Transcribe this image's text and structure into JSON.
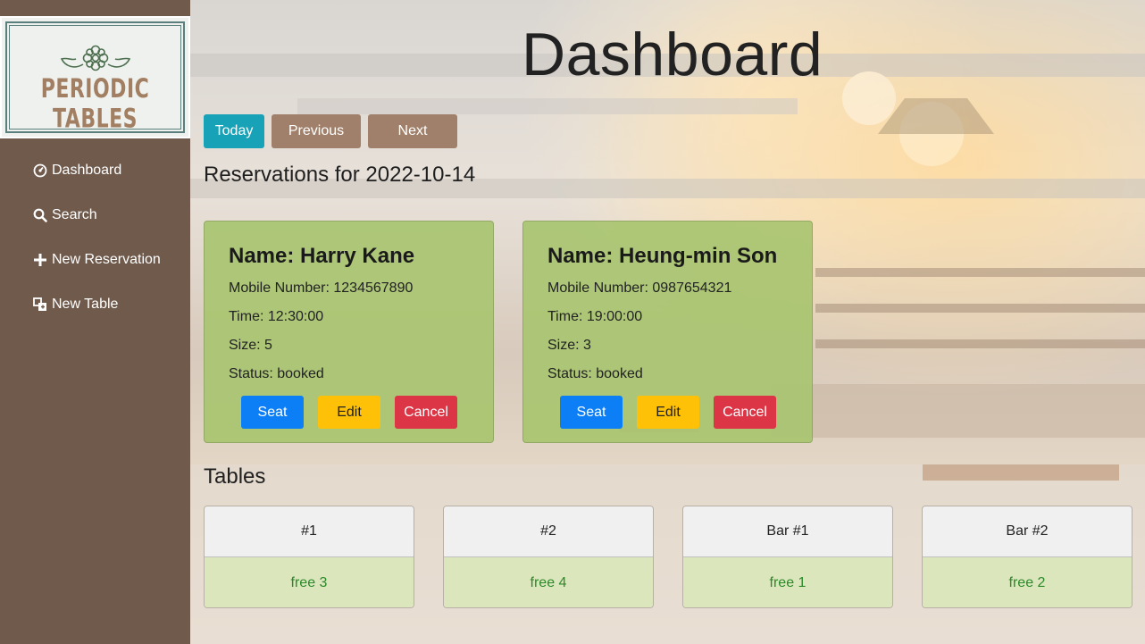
{
  "sidebar": {
    "logo_text": "PERIODIC TABLES",
    "items": [
      {
        "label": "Dashboard",
        "icon": "dashboard-icon"
      },
      {
        "label": "Search",
        "icon": "search-icon"
      },
      {
        "label": "New Reservation",
        "icon": "plus-icon"
      },
      {
        "label": "New Table",
        "icon": "new-table-icon"
      }
    ]
  },
  "header": {
    "title": "Dashboard"
  },
  "date_nav": {
    "today": "Today",
    "previous": "Previous",
    "next": "Next"
  },
  "reservations": {
    "heading": "Reservations for 2022-10-14",
    "items": [
      {
        "name": "Name: Harry Kane",
        "mobile": "Mobile Number: 1234567890",
        "time": "Time: 12:30:00",
        "size": "Size: 5",
        "status": "Status: booked",
        "seat": "Seat",
        "edit": "Edit",
        "cancel": "Cancel"
      },
      {
        "name": "Name: Heung-min Son",
        "mobile": "Mobile Number: 0987654321",
        "time": "Time: 19:00:00",
        "size": "Size: 3",
        "status": "Status: booked",
        "seat": "Seat",
        "edit": "Edit",
        "cancel": "Cancel"
      }
    ]
  },
  "tables": {
    "heading": "Tables",
    "items": [
      {
        "name": "#1",
        "status": "free 3"
      },
      {
        "name": "#2",
        "status": "free 4"
      },
      {
        "name": "Bar #1",
        "status": "free 1"
      },
      {
        "name": "Bar #2",
        "status": "free 2"
      }
    ]
  },
  "colors": {
    "sidebar": "#6f5a4c",
    "today_button": "#17a2b8",
    "nav_button": "#a0806a",
    "card": "#a8c470",
    "seat": "#0d7ff6",
    "edit": "#fec107",
    "cancel": "#dc3545",
    "free": "#2a8a2a"
  }
}
